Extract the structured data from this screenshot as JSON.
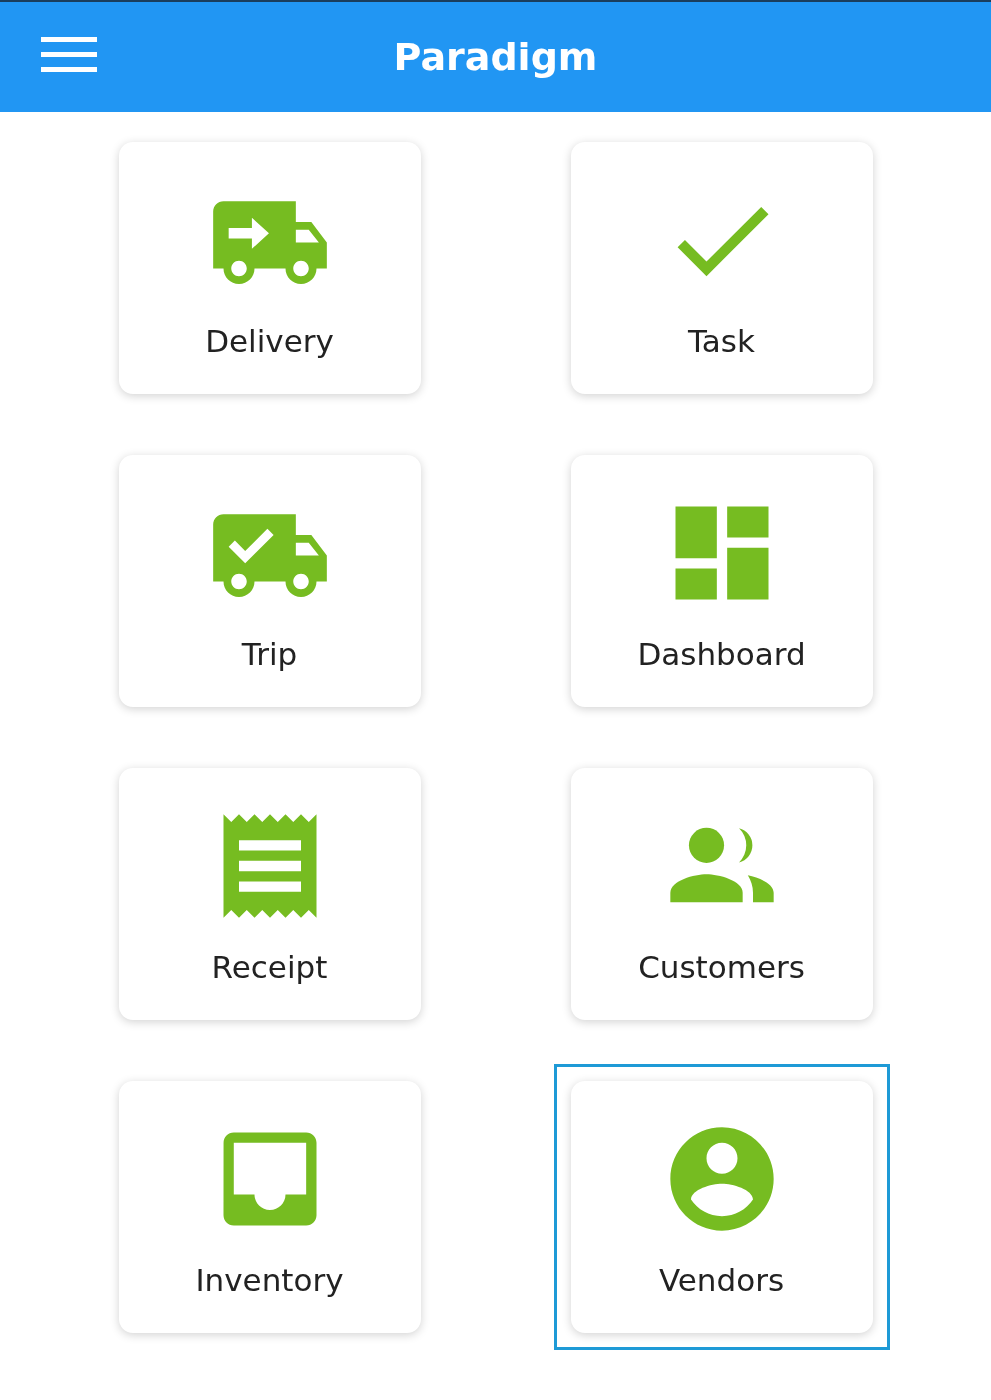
{
  "header": {
    "title": "Paradigm"
  },
  "tiles": [
    {
      "kind": "delivery",
      "label": "Delivery",
      "selected": false
    },
    {
      "kind": "task",
      "label": "Task",
      "selected": false
    },
    {
      "kind": "trip",
      "label": "Trip",
      "selected": false
    },
    {
      "kind": "dashboard",
      "label": "Dashboard",
      "selected": false
    },
    {
      "kind": "receipt",
      "label": "Receipt",
      "selected": false
    },
    {
      "kind": "customers",
      "label": "Customers",
      "selected": false
    },
    {
      "kind": "inventory",
      "label": "Inventory",
      "selected": false
    },
    {
      "kind": "vendors",
      "label": "Vendors",
      "selected": true
    }
  ]
}
